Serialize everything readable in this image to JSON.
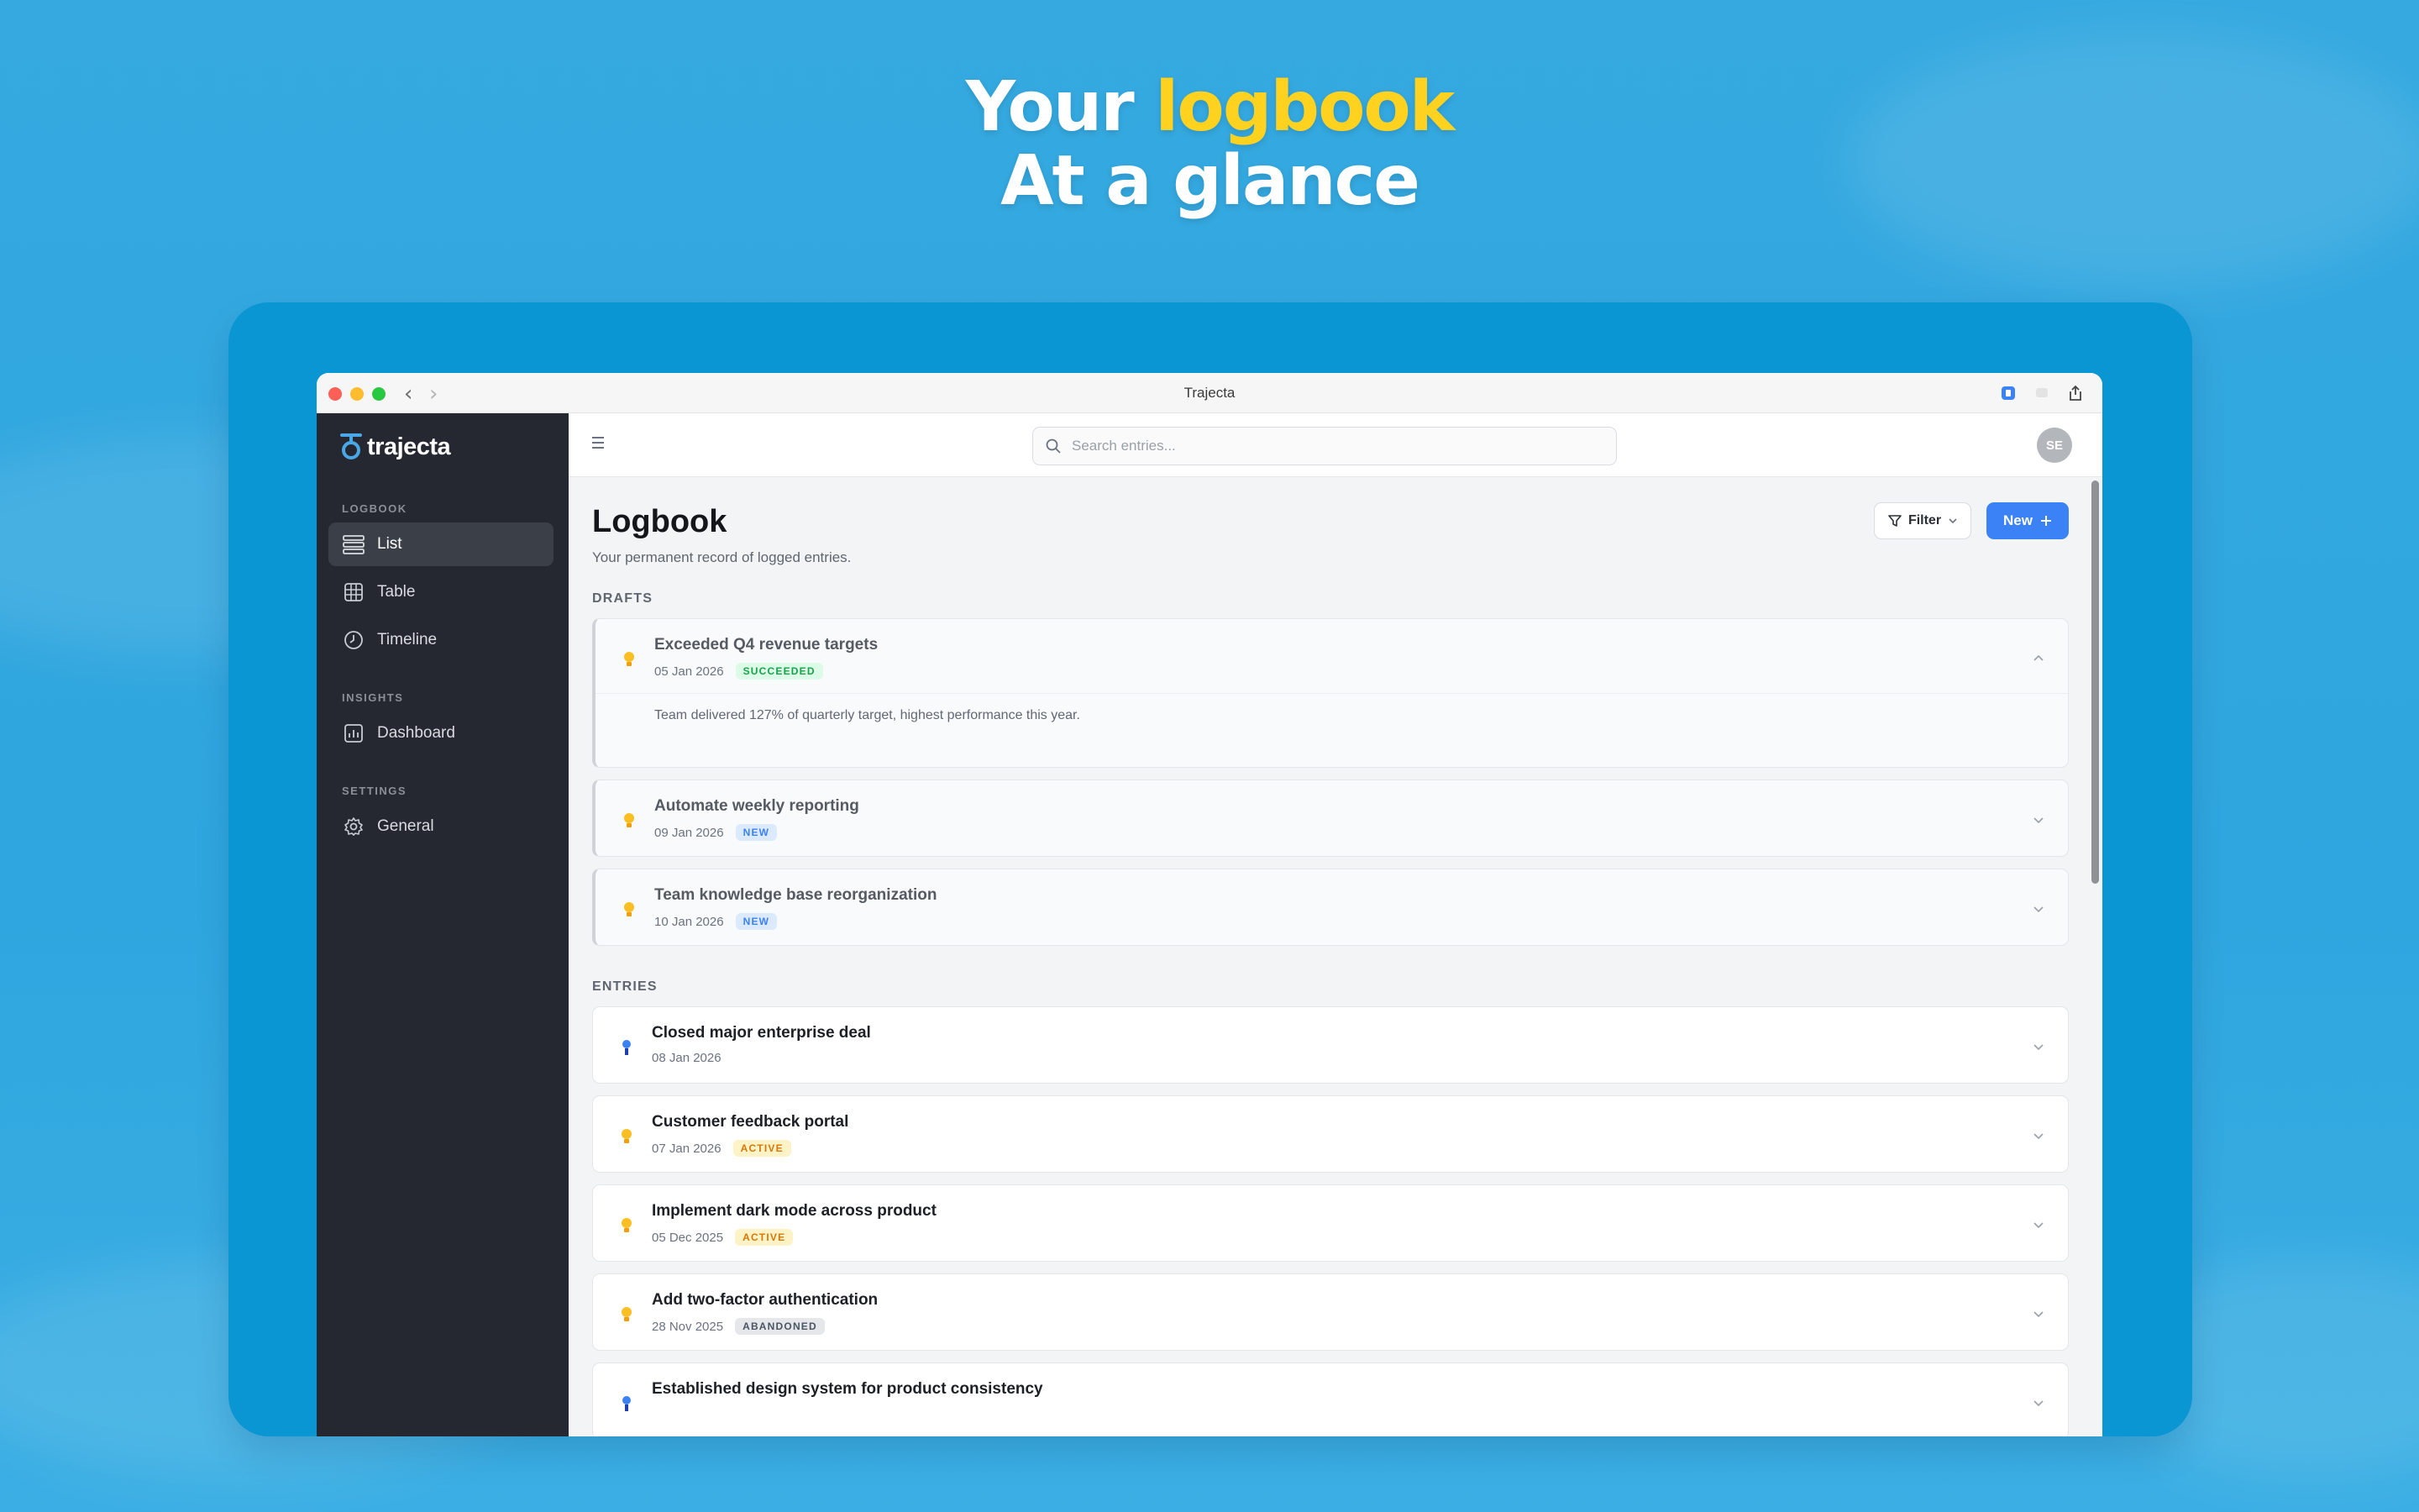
{
  "headline": {
    "line1_pre": "Your ",
    "line1_highlight": "logbook",
    "line2": "At a glance"
  },
  "window": {
    "title": "Trajecta"
  },
  "sidebar": {
    "logo_text": "trajecta",
    "sections": [
      {
        "label": "LOGBOOK",
        "items": [
          {
            "label": "List",
            "icon": "list-icon",
            "active": true
          },
          {
            "label": "Table",
            "icon": "grid-icon"
          },
          {
            "label": "Timeline",
            "icon": "clock-icon"
          }
        ]
      },
      {
        "label": "INSIGHTS",
        "items": [
          {
            "label": "Dashboard",
            "icon": "chart-icon"
          }
        ]
      },
      {
        "label": "SETTINGS",
        "items": [
          {
            "label": "General",
            "icon": "gear-icon"
          }
        ]
      }
    ]
  },
  "topbar": {
    "search_placeholder": "Search entries...",
    "avatar_initials": "SE"
  },
  "page": {
    "title": "Logbook",
    "subtitle": "Your permanent record of logged entries.",
    "filter_label": "Filter",
    "new_label": "New"
  },
  "drafts": {
    "label": "DRAFTS",
    "items": [
      {
        "title": "Exceeded Q4 revenue targets",
        "date": "05 Jan 2026",
        "badge": "SUCCEEDED",
        "expanded": true,
        "description": "Team delivered 127% of quarterly target, highest performance this year.",
        "icon": "lightbulb-icon"
      },
      {
        "title": "Automate weekly reporting",
        "date": "09 Jan 2026",
        "badge": "NEW",
        "icon": "lightbulb-icon"
      },
      {
        "title": "Team knowledge base reorganization",
        "date": "10 Jan 2026",
        "badge": "NEW",
        "icon": "lightbulb-icon"
      }
    ]
  },
  "entries": {
    "label": "ENTRIES",
    "items": [
      {
        "title": "Closed major enterprise deal",
        "date": "08 Jan 2026",
        "badge": "",
        "icon": "medal-icon"
      },
      {
        "title": "Customer feedback portal",
        "date": "07 Jan 2026",
        "badge": "ACTIVE",
        "icon": "lightbulb-icon"
      },
      {
        "title": "Implement dark mode across product",
        "date": "05 Dec 2025",
        "badge": "ACTIVE",
        "icon": "lightbulb-icon"
      },
      {
        "title": "Add two-factor authentication",
        "date": "28 Nov 2025",
        "badge": "ABANDONED",
        "icon": "lightbulb-icon"
      },
      {
        "title": "Established design system for product consistency",
        "date": "",
        "badge": "",
        "icon": "medal-icon"
      }
    ]
  },
  "colors": {
    "background": "#35a9e0",
    "frame": "#0a95d3",
    "highlight": "#ffd21f",
    "sidebar": "#252830",
    "accent": "#3b82f6"
  }
}
